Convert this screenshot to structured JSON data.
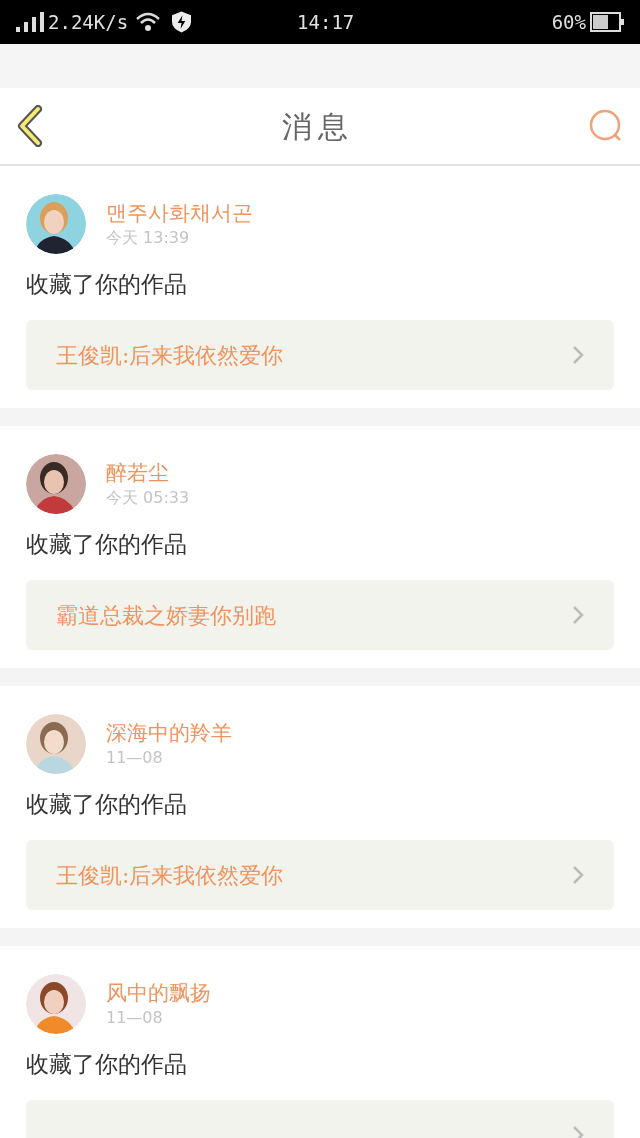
{
  "status_bar": {
    "speed": "2.24K/s",
    "time": "14:17",
    "battery": "60%"
  },
  "header": {
    "title": "消息"
  },
  "messages": [
    {
      "user": "맨주사화채서곤",
      "time": "今天 13:39",
      "action": "收藏了你的作品",
      "work": "王俊凯:后来我依然爱你"
    },
    {
      "user": "醉若尘",
      "time": "今天 05:33",
      "action": "收藏了你的作品",
      "work": "霸道总裁之娇妻你别跑"
    },
    {
      "user": "深海中的羚羊",
      "time": "11—08",
      "action": "收藏了你的作品",
      "work": "王俊凯:后来我依然爱你"
    },
    {
      "user": "风中的飘扬",
      "time": "11—08",
      "action": "收藏了你的作品"
    }
  ]
}
